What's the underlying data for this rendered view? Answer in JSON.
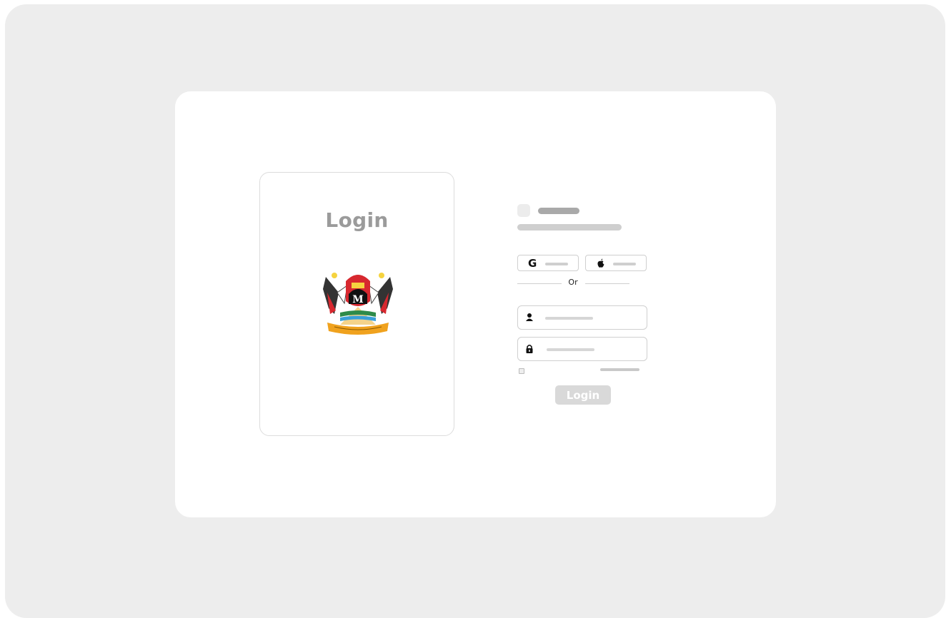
{
  "left_panel": {
    "title": "Login"
  },
  "social": {
    "google_icon": "G",
    "apple_icon": ""
  },
  "divider": {
    "label": "Or"
  },
  "form": {
    "submit_label": "Login"
  },
  "icons": {
    "google": "google-icon",
    "apple": "apple-icon",
    "user": "user-icon",
    "lock": "lock-icon",
    "checkbox": "checkbox-icon"
  },
  "colors": {
    "placeholder": "#c9c9c9",
    "button": "#d9d9d9",
    "title": "#9b9b9b"
  }
}
